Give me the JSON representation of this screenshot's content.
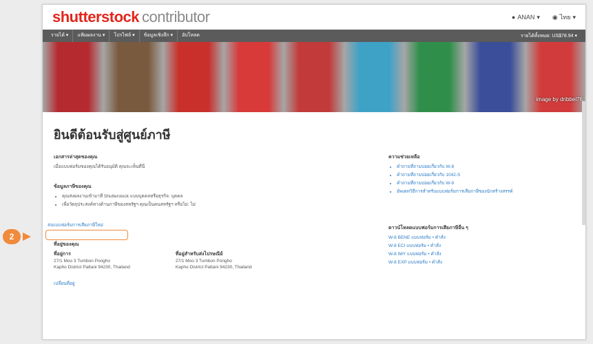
{
  "header": {
    "brand": "shutterstock",
    "sub": "contributor",
    "user": "ANAN",
    "language": "ไทย"
  },
  "nav": {
    "items": [
      "รายได้",
      "แฟ้มผลงาน",
      "โปรไฟล์",
      "ข้อมูลเชิงลึก",
      "อัปโหลด"
    ],
    "earnings": "รายได้ทั้งหมด: US$78.94"
  },
  "banner": {
    "credit": "image by dribbel76",
    "colors": [
      "#b52a2f",
      "#7a5a3e",
      "#c9302c",
      "#d83a3a",
      "#c23a3a",
      "#3ea2c6",
      "#2f8f4a",
      "#3b4e9a",
      "#d23b3b"
    ]
  },
  "page": {
    "title": "ยินดีต้อนรับสู่ศูนย์ภาษี"
  },
  "documents": {
    "heading": "เอกสารล่าสุดของคุณ",
    "text": "เมื่อแบบฟอร์มของคุณได้รับอนุมัติ คุณจะเห็นที่นี่"
  },
  "tax_info": {
    "heading": "ข้อมูลภาษีของคุณ",
    "bullets": [
      "คุณส่งผลงานเข้ามาที่ Shutterstock แบบบุคคลหรือธุรกิจ: บุคคล",
      "เพื่อวัตถุประสงค์ทางด้านภาษีของสหรัฐฯ คุณเป็นคนสหรัฐฯ หรือไม่: ไม่"
    ],
    "link": "ส่งแบบฟอร์มการเสียภาษีใหม่"
  },
  "address": {
    "heading": "ที่อยู่ของคุณ",
    "home_label": "ที่อยู่การ",
    "home_lines": [
      "27/1 Moo 3 Tumbon Pongho",
      "Kapho District Pattani 94230, Thailand"
    ],
    "mail_label": "ที่อยู่สำหรับส่งไปรษณีย์",
    "mail_lines": [
      "27/1 Moo 3 Tumbon Pongho",
      "Kapho District Pattani 94230, Thailand"
    ],
    "change_link": "เปลี่ยนที่อยู่"
  },
  "help": {
    "heading": "ความช่วยเหลือ",
    "links": [
      "คำถามที่ถามบ่อยเกี่ยวกับ W-8",
      "คำถามที่ถามบ่อยเกี่ยวกับ 1042-S",
      "คำถามที่ถามบ่อยเกี่ยวกับ W-9",
      "อัพเดทวิธีการสำหรับแบบฟอร์มการเสียภาษีของนักสร้างสรรค์"
    ]
  },
  "downloads": {
    "heading": "ดาวน์โหลดแบบฟอร์มการเสียภาษีอื่น ๆ",
    "items": [
      "W-8 BENE แบบฟอร์ม • คำสั่ง",
      "W-8 ECI แบบฟอร์ม • คำสั่ง",
      "W-8 IMY แบบฟอร์ม • คำสั่ง",
      "W-8 EXP แบบฟอร์ม • คำสั่ง"
    ]
  },
  "annotation": {
    "step": "2",
    "color": "#f08a3c"
  }
}
